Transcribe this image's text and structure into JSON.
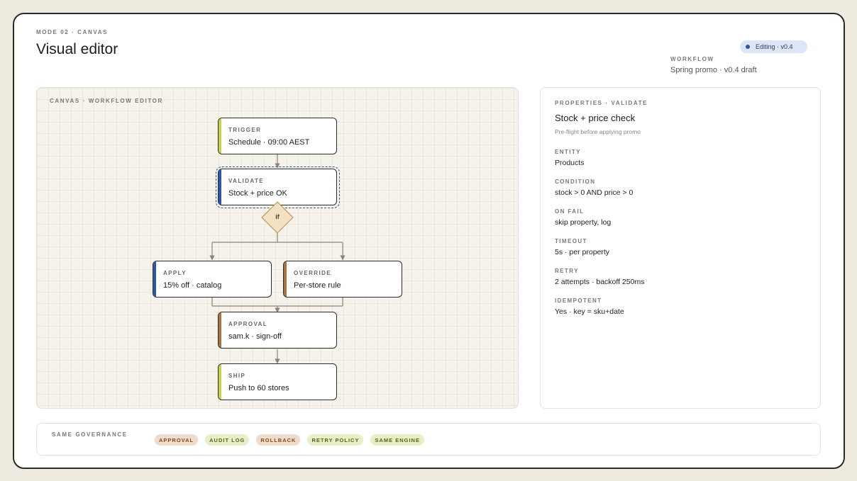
{
  "header": {
    "mode_label": "MODE 02 · CANVAS",
    "title": "Visual editor",
    "status": "Editing · v0.4",
    "workflow_label": "WORKFLOW",
    "workflow_name": "Spring promo · v0.4 draft"
  },
  "canvas": {
    "label": "CANVAS · WORKFLOW EDITOR",
    "decision_label": "if",
    "nodes": [
      {
        "kind": "TRIGGER",
        "text": "Schedule · 09:00 AEST",
        "accent": "#c6d34a"
      },
      {
        "kind": "VALIDATE",
        "text": "Stock + price OK",
        "accent": "#2f55a5"
      },
      {
        "kind": "APPLY",
        "text": "15% off · catalog",
        "accent": "#2f55a5"
      },
      {
        "kind": "OVERRIDE",
        "text": "Per-store rule",
        "accent": "#a8743f"
      },
      {
        "kind": "APPROVAL",
        "text": "sam.k · sign-off",
        "accent": "#a8743f"
      },
      {
        "kind": "SHIP",
        "text": "Push to 60 stores",
        "accent": "#c6d34a"
      }
    ]
  },
  "properties": {
    "header": "PROPERTIES · VALIDATE",
    "name": "Stock + price check",
    "subtitle": "Pre-flight before applying promo",
    "fields": [
      {
        "key": "ENTITY",
        "value": "Products"
      },
      {
        "key": "CONDITION",
        "value": "stock > 0 AND price > 0"
      },
      {
        "key": "ON FAIL",
        "value": "skip property, log"
      },
      {
        "key": "TIMEOUT",
        "value": "5s · per property"
      },
      {
        "key": "RETRY",
        "value": "2 attempts · backoff 250ms"
      },
      {
        "key": "IDEMPOTENT",
        "value": "Yes · key = sku+date"
      }
    ]
  },
  "governance": {
    "label": "SAME GOVERNANCE",
    "tags": [
      {
        "label": "APPROVAL",
        "bg": "#f0dccb",
        "fg": "#7a4a24"
      },
      {
        "label": "AUDIT LOG",
        "bg": "#e7efc6",
        "fg": "#55621e"
      },
      {
        "label": "ROLLBACK",
        "bg": "#f0dccb",
        "fg": "#7a4a24"
      },
      {
        "label": "RETRY POLICY",
        "bg": "#e7efc6",
        "fg": "#55621e"
      },
      {
        "label": "SAME ENGINE",
        "bg": "#e7efc6",
        "fg": "#55621e"
      }
    ]
  }
}
